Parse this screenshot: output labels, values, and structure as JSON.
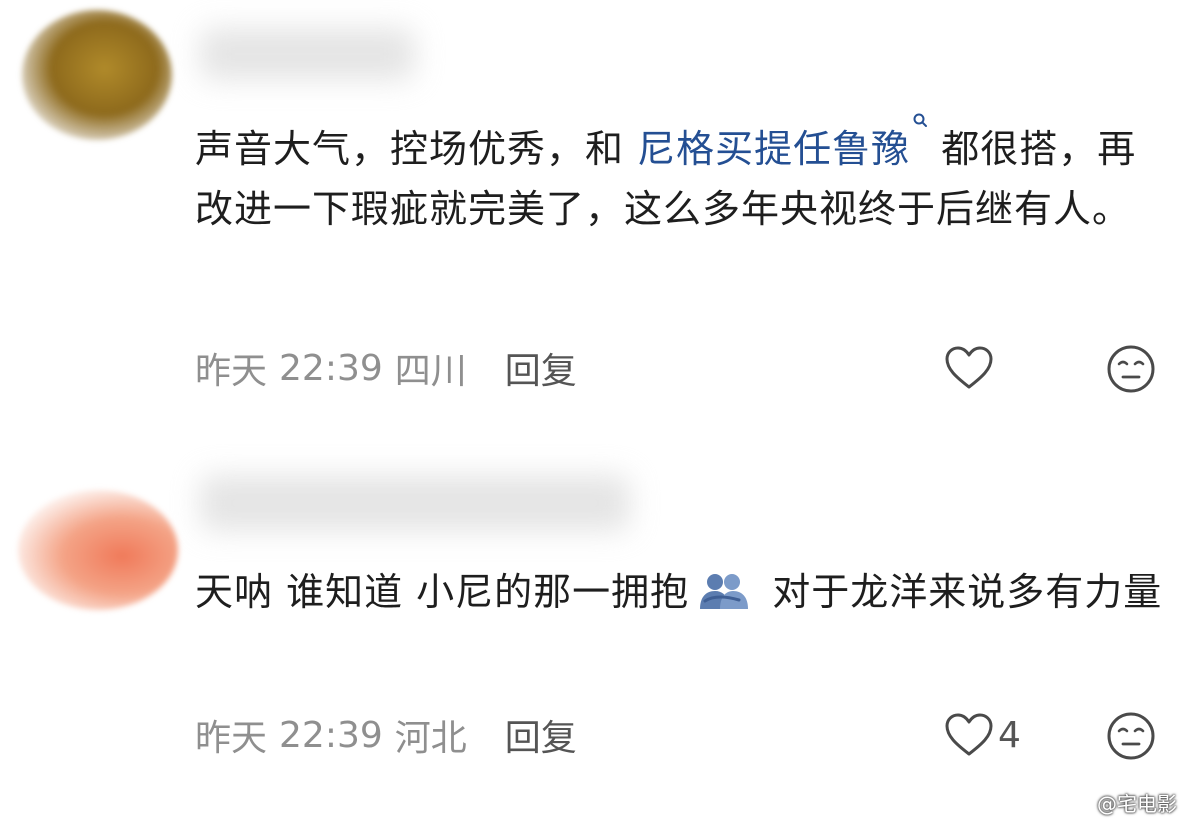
{
  "comments": [
    {
      "text_before_link": "声音大气，控场优秀，和 ",
      "link": "尼格买提任鲁豫",
      "text_after_link": " 都很搭，再改进一下瑕疵就完美了，这么多年央视终于后继有人。",
      "date": "昨天",
      "time": "22:39",
      "location": "四川",
      "reply_label": "回复",
      "like_count": ""
    },
    {
      "text_before_icon": "天呐 谁知道 小尼的那一拥抱",
      "text_after_icon": " 对于龙洋来说多有力量",
      "date": "昨天",
      "time": "22:39",
      "location": "河北",
      "reply_label": "回复",
      "like_count": "4"
    }
  ],
  "icons": {
    "link_icon": "search-icon",
    "emoji": "hug-icon",
    "like": "heart-outline-icon",
    "dislike": "neutral-face-icon"
  },
  "colors": {
    "link": "#244f93",
    "meta": "#8f8f8f",
    "icon": "#4a4a4a"
  },
  "watermark": "@宅电影"
}
